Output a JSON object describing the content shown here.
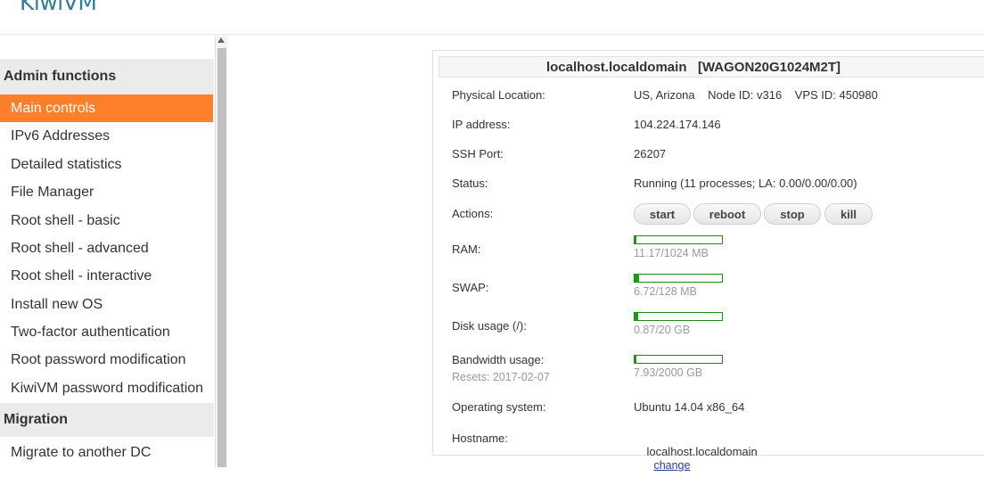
{
  "app": {
    "logo": "KiwiVM"
  },
  "sidebar": {
    "sections": [
      {
        "title": "Admin functions"
      },
      {
        "title": "Migration"
      }
    ],
    "items": [
      {
        "label": "Main controls",
        "active": true
      },
      {
        "label": "IPv6 Addresses"
      },
      {
        "label": "Detailed statistics"
      },
      {
        "label": "File Manager"
      },
      {
        "label": "Root shell - basic"
      },
      {
        "label": "Root shell - advanced"
      },
      {
        "label": "Root shell - interactive"
      },
      {
        "label": "Install new OS"
      },
      {
        "label": "Two-factor authentication"
      },
      {
        "label": "Root password modification"
      },
      {
        "label": "KiwiVM password modification"
      }
    ],
    "migration_items": [
      {
        "label": "Migrate to another DC"
      }
    ]
  },
  "panel": {
    "title": "localhost.localdomain   [WAGON20G1024M2T]",
    "physical_location": {
      "label": "Physical Location:",
      "value": "US, Arizona    Node ID: v316    VPS ID: 450980"
    },
    "ip": {
      "label": "IP address:",
      "value": "104.224.174.146"
    },
    "ssh": {
      "label": "SSH Port:",
      "value": "26207"
    },
    "status": {
      "label": "Status:",
      "value": "Running (11 processes; LA: 0.00/0.00/0.00)"
    },
    "actions": {
      "label": "Actions:",
      "buttons": [
        "start",
        "reboot",
        "stop",
        "kill"
      ]
    },
    "ram": {
      "label": "RAM:",
      "caption": "11.17/1024 MB",
      "fraction": 0.011
    },
    "swap": {
      "label": "SWAP:",
      "caption": "6.72/128 MB",
      "fraction": 0.0525
    },
    "disk": {
      "label": "Disk usage (/):",
      "caption": "0.87/20 GB",
      "fraction": 0.0435
    },
    "bandwidth": {
      "label": "Bandwidth usage:",
      "resets": "Resets: 2017-02-07",
      "caption": "7.93/2000 GB",
      "fraction": 0.004
    },
    "os": {
      "label": "Operating system:",
      "value": "Ubuntu 14.04 x86_64"
    },
    "hostname": {
      "label": "Hostname:",
      "value": "localhost.localdomain",
      "change_link": "change"
    }
  },
  "colors": {
    "accent": "#ff7f2a",
    "bar": "#1a9c1a",
    "logo": "#2f7f94"
  }
}
